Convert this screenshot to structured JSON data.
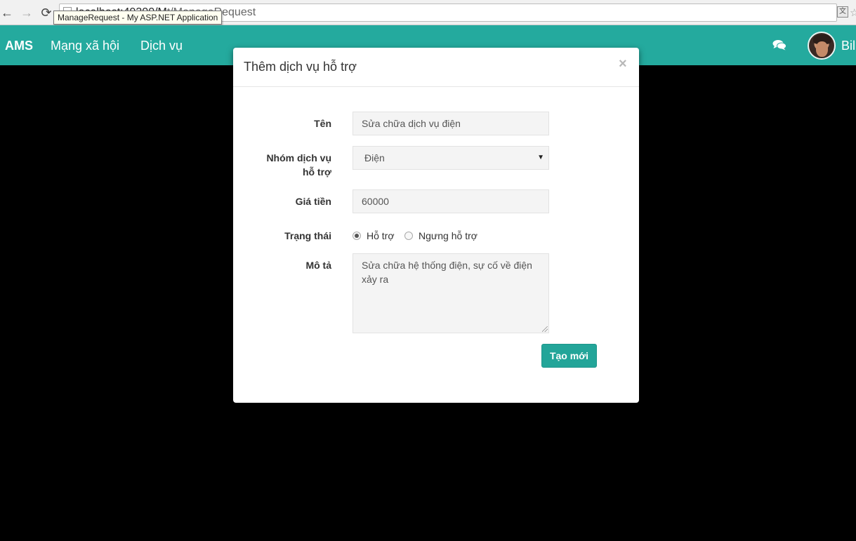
{
  "browser": {
    "url_prefix": "localhost:49300/M",
    "url_suffix": "t/ManageRequest",
    "tooltip": "ManageRequest - My ASP.NET Application"
  },
  "navbar": {
    "brand": "AMS",
    "links": [
      "Mạng xã hội",
      "Dịch vụ"
    ],
    "username": "Bil",
    "bg_color": "#24aa9e"
  },
  "modal": {
    "title": "Thêm dịch vụ hỗ trợ",
    "close": "×",
    "fields": {
      "name_label": "Tên",
      "name_value": "Sửa chữa dịch vụ điện",
      "group_label_line1": "Nhóm dịch vụ",
      "group_label_line2": "hỗ trợ",
      "group_selected": "Điện",
      "price_label": "Giá tiền",
      "price_value": "60000",
      "status_label": "Trạng thái",
      "status_options": [
        "Hỗ trợ",
        "Ngưng hỗ trợ"
      ],
      "status_selected": "Hỗ trợ",
      "desc_label": "Mô tả",
      "desc_value": "Sửa chữa hệ thống điện, sự cố về điện xảy ra"
    },
    "submit": "Tạo mới"
  }
}
